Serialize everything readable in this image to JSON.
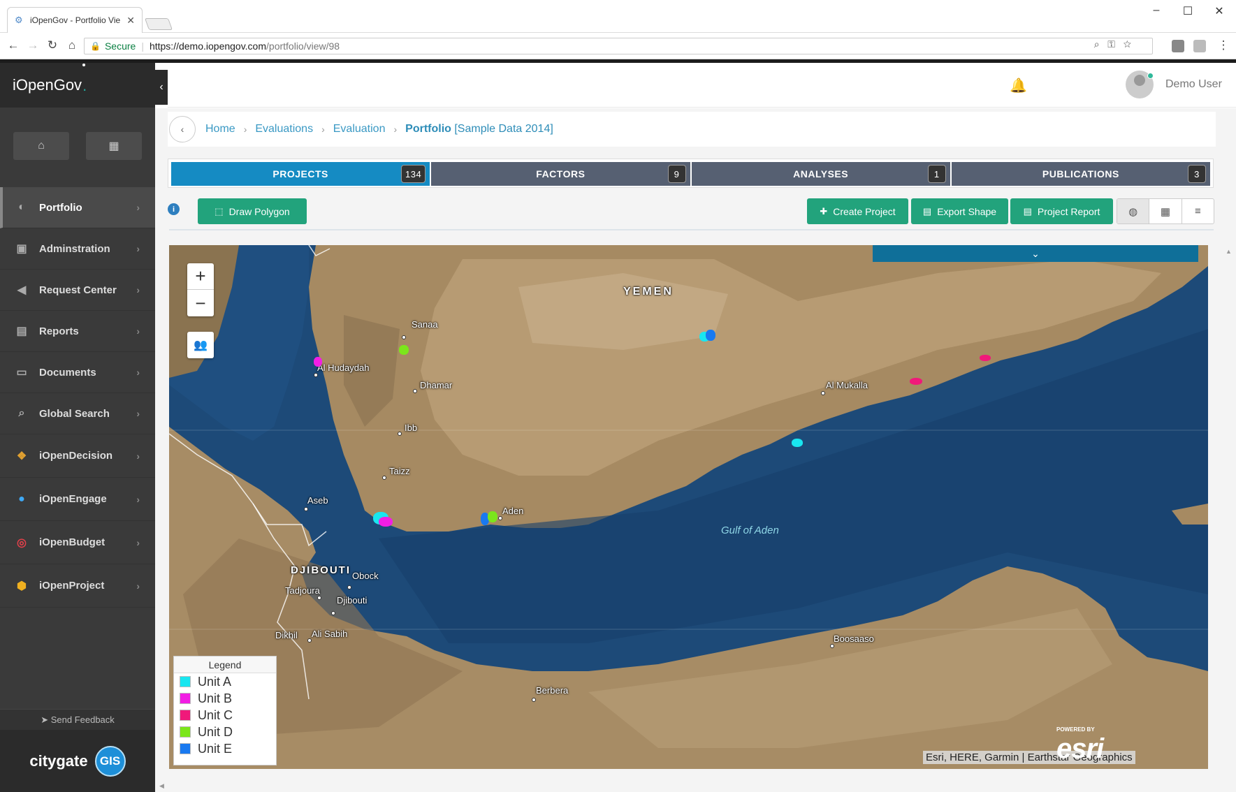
{
  "browser": {
    "tab_title": "iOpenGov - Portfolio Vie",
    "secure_label": "Secure",
    "url_host": "https://demo.iopengov.com",
    "url_path": "/portfolio/view/98"
  },
  "sidebar": {
    "brand": "iOpenGov",
    "brand_dot": ".",
    "items": [
      {
        "label": "Portfolio",
        "icon": "palette-icon"
      },
      {
        "label": "Adminstration",
        "icon": "lock-icon"
      },
      {
        "label": "Request Center",
        "icon": "megaphone-icon"
      },
      {
        "label": "Reports",
        "icon": "document-icon"
      },
      {
        "label": "Documents",
        "icon": "folder-icon"
      },
      {
        "label": "Global Search",
        "icon": "search-icon"
      },
      {
        "label": "iOpenDecision",
        "icon": "decision-icon"
      },
      {
        "label": "iOpenEngage",
        "icon": "engage-icon"
      },
      {
        "label": "iOpenBudget",
        "icon": "budget-icon"
      },
      {
        "label": "iOpenProject",
        "icon": "project-icon"
      }
    ],
    "feedback": "Send Feedback",
    "footer_brand": "citygate",
    "footer_badge": "GIS"
  },
  "header": {
    "username": "Demo User"
  },
  "breadcrumb": {
    "items": [
      "Home",
      "Evaluations",
      "Evaluation"
    ],
    "current": "Portfolio",
    "current_sub": "[Sample Data 2014]"
  },
  "tabs": [
    {
      "label": "PROJECTS",
      "count": "134"
    },
    {
      "label": "FACTORS",
      "count": "9"
    },
    {
      "label": "ANALYSES",
      "count": "1"
    },
    {
      "label": "PUBLICATIONS",
      "count": "3"
    }
  ],
  "toolbar": {
    "draw_polygon": "Draw Polygon",
    "create_project": "Create Project",
    "export_shape": "Export Shape",
    "project_report": "Project Report"
  },
  "map": {
    "labels": {
      "yemen": "YEMEN",
      "sanaa": "Sanaa",
      "al_hudaydah": "Al Hudaydah",
      "dhamar": "Dhamar",
      "ibb": "Ibb",
      "taizz": "Taizz",
      "aden": "Aden",
      "al_mukalla": "Al Mukalla",
      "aseb": "Aseb",
      "djibouti_country": "DJIBOUTI",
      "obock": "Obock",
      "tadjoura": "Tadjoura",
      "djibouti_city": "Djibouti",
      "dikhil": "Dikhil",
      "ali_sabih": "Ali Sabih",
      "boosaaso": "Boosaaso",
      "berbera": "Berbera",
      "gulf": "Gulf of Aden"
    },
    "legend_title": "Legend",
    "legend": [
      {
        "label": "Unit A",
        "color": "#19e6f0"
      },
      {
        "label": "Unit B",
        "color": "#f21ee4"
      },
      {
        "label": "Unit C",
        "color": "#f0197a"
      },
      {
        "label": "Unit D",
        "color": "#7be61b"
      },
      {
        "label": "Unit E",
        "color": "#1979f0"
      }
    ],
    "attribution": "Esri, HERE, Garmin | Earthstar Geographics",
    "powered_by": "POWERED BY",
    "esri": "esri"
  }
}
